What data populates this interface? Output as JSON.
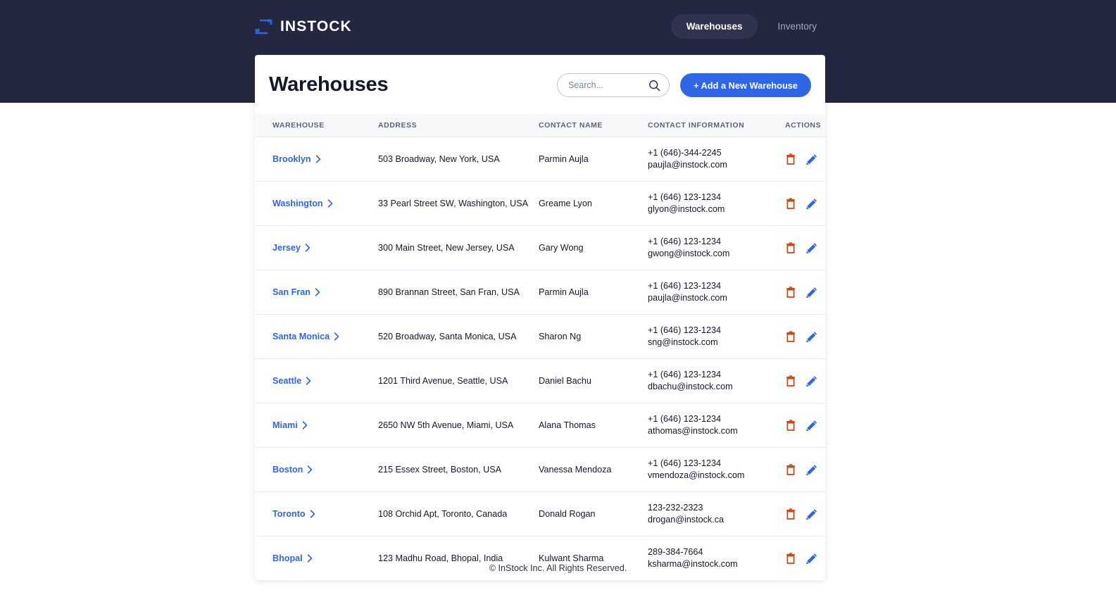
{
  "header": {
    "brand_name": "INSTOCK",
    "brand_icon": "repeat-arrows-icon",
    "nav": [
      {
        "label": "Warehouses",
        "active": true
      },
      {
        "label": "Inventory",
        "active": false
      }
    ]
  },
  "main": {
    "title": "Warehouses",
    "search": {
      "value": "",
      "placeholder": "Search...",
      "icon": "search-icon"
    },
    "add_button": {
      "label": "+ Add a New Warehouse"
    },
    "columns": [
      "WAREHOUSE",
      "ADDRESS",
      "CONTACT NAME",
      "CONTACT INFORMATION",
      "ACTIONS"
    ],
    "rows": [
      {
        "warehouse": "Brooklyn",
        "address": "503 Broadway, New York, USA",
        "contact_name": "Parmin Aujla",
        "phone": "+1 (646)-344-2245",
        "email": "paujla@instock.com"
      },
      {
        "warehouse": "Washington",
        "address": "33 Pearl Street SW, Washington, USA",
        "contact_name": "Greame Lyon",
        "phone": "+1 (646) 123-1234",
        "email": "glyon@instock.com"
      },
      {
        "warehouse": "Jersey",
        "address": "300 Main Street, New Jersey, USA",
        "contact_name": "Gary Wong",
        "phone": "+1 (646) 123-1234",
        "email": "gwong@instock.com"
      },
      {
        "warehouse": "San Fran",
        "address": "890 Brannan Street, San Fran, USA",
        "contact_name": "Parmin Aujla",
        "phone": "+1 (646) 123-1234",
        "email": "paujla@instock.com"
      },
      {
        "warehouse": "Santa Monica",
        "address": "520 Broadway, Santa Monica, USA",
        "contact_name": "Sharon Ng",
        "phone": "+1 (646) 123-1234",
        "email": "sng@instock.com"
      },
      {
        "warehouse": "Seattle",
        "address": "1201 Third Avenue, Seattle, USA",
        "contact_name": "Daniel Bachu",
        "phone": "+1 (646) 123-1234",
        "email": "dbachu@instock.com"
      },
      {
        "warehouse": "Miami",
        "address": "2650 NW 5th Avenue, Miami, USA",
        "contact_name": "Alana Thomas",
        "phone": "+1 (646) 123-1234",
        "email": "athomas@instock.com"
      },
      {
        "warehouse": "Boston",
        "address": "215 Essex Street, Boston, USA",
        "contact_name": "Vanessa Mendoza",
        "phone": "+1 (646) 123-1234",
        "email": "vmendoza@instock.com"
      },
      {
        "warehouse": "Toronto",
        "address": "108 Orchid Apt, Toronto, Canada",
        "contact_name": "Donald Rogan",
        "phone": "123-232-2323",
        "email": "drogan@instock.ca"
      },
      {
        "warehouse": "Bhopal",
        "address": "123 Madhu Road, Bhopal, India",
        "contact_name": "Kulwant Sharma",
        "phone": "289-384-7664",
        "email": "ksharma@instock.com"
      }
    ],
    "row_actions": {
      "delete_icon": "trash-icon",
      "edit_icon": "pencil-icon"
    }
  },
  "footer": {
    "copyright": "© InStock Inc. All Rights Reserved."
  },
  "colors": {
    "header_bg": "#232740",
    "accent_blue": "#2e66e6",
    "delete_red": "#c94515",
    "table_head_bg": "#f7f8fa"
  }
}
